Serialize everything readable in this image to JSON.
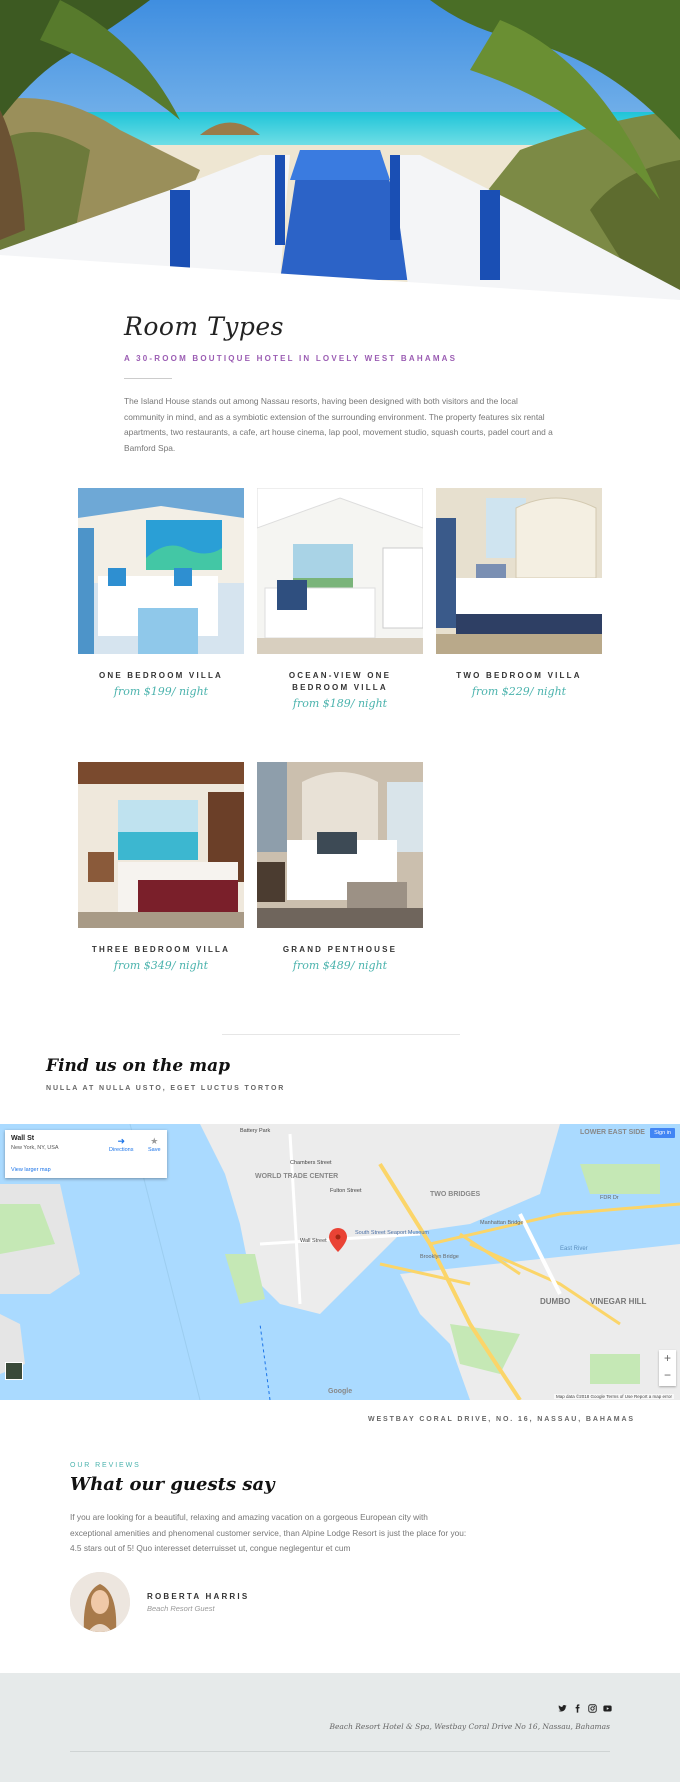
{
  "intro": {
    "title": "Room Types",
    "subtitle": "A 30-ROOM BOUTIQUE HOTEL IN LOVELY WEST BAHAMAS",
    "description": "The Island House stands out among Nassau resorts, having been designed with both visitors and the local community in mind, and as a symbiotic extension of the surrounding environment. The property features six rental apartments, two restaurants, a cafe, art house cinema, lap pool, movement studio, squash courts, padel court and a Bamford Spa."
  },
  "rooms": [
    {
      "name": "ONE BEDROOM VILLA",
      "price": "from $199/ night"
    },
    {
      "name": "OCEAN-VIEW ONE BEDROOM VILLA",
      "price": "from $189/ night"
    },
    {
      "name": "TWO BEDROOM VILLA",
      "price": "from $229/ night"
    },
    {
      "name": "THREE BEDROOM VILLA",
      "price": "from $349/ night"
    },
    {
      "name": "GRAND PENTHOUSE",
      "price": "from $489/ night"
    }
  ],
  "map_section": {
    "title": "Find us on the map",
    "subtitle": "NULLA AT NULLA USTO, EGET LUCTUS TORTOR",
    "address": "WESTBAY CORAL DRIVE, NO. 16, NASSAU, BAHAMAS",
    "card": {
      "place": "Wall St",
      "address": "New York, NY, USA",
      "directions": "Directions",
      "save": "Save",
      "larger_map": "View larger map"
    },
    "sign_in": "Sign in",
    "google": "Google",
    "terms": "Map data ©2018 Google   Terms of Use   Report a map error",
    "zoom_in": "+",
    "zoom_out": "−",
    "labels": [
      "WORLD TRADE CENTER",
      "TWO BRIDGES",
      "DUMBO",
      "VINEGAR HILL",
      "LOWER EAST SIDE",
      "FDR Dr",
      "East River",
      "Brooklyn Bridge",
      "Manhattan Bridge",
      "South Street Seaport Museum",
      "Wall Street",
      "Battery Park",
      "Fulton Street",
      "Chambers Street"
    ]
  },
  "reviews": {
    "label": "OUR REVIEWS",
    "title": "What our guests say",
    "text": "If you are looking for a beautiful, relaxing and amazing vacation on a gorgeous European city with exceptional amenities and phenomenal customer service, than Alpine Lodge Resort is just the place for you: 4.5 stars out of 5! Quo interesset deterruisset ut, congue neglegentur et cum",
    "name": "ROBERTA HARRIS",
    "role": "Beach Resort Guest"
  },
  "footer": {
    "address": "Beach Resort Hotel & Spa, Westbay Coral Drive No 16, Nassau, Bahamas",
    "social_icons": [
      "twitter-icon",
      "facebook-icon",
      "instagram-icon",
      "youtube-icon"
    ]
  },
  "colors": {
    "accent_purple": "#9b5db3",
    "accent_teal": "#4bb3ad",
    "footer_bg": "#e6eaea",
    "map_water": "#aadaff"
  }
}
